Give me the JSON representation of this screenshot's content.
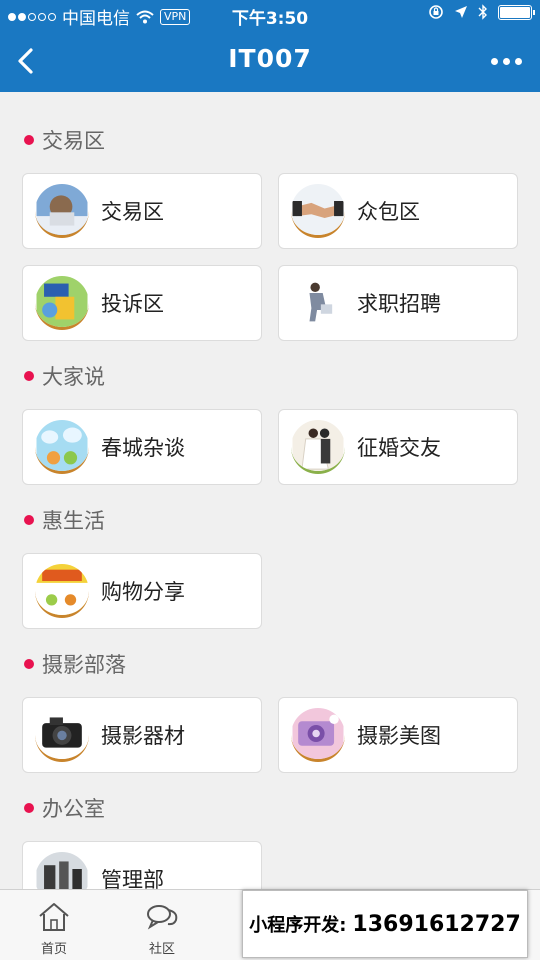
{
  "status_bar": {
    "carrier": "中国电信",
    "vpn": "VPN",
    "time": "下午3:50"
  },
  "nav": {
    "title": "IT007"
  },
  "sections": [
    {
      "title": "交易区",
      "items": [
        {
          "label": "交易区",
          "icon": "trade-icon"
        },
        {
          "label": "众包区",
          "icon": "handshake-icon"
        }
      ]
    },
    {
      "title": "",
      "items": [
        {
          "label": "投诉区",
          "icon": "complaint-icon"
        },
        {
          "label": "求职招聘",
          "icon": "job-icon"
        }
      ]
    },
    {
      "title": "大家说",
      "items": [
        {
          "label": "春城杂谈",
          "icon": "chat-icon"
        },
        {
          "label": "征婚交友",
          "icon": "wedding-icon"
        }
      ]
    },
    {
      "title": "惠生活",
      "items": [
        {
          "label": "购物分享",
          "icon": "shopping-icon"
        }
      ]
    },
    {
      "title": "摄影部落",
      "items": [
        {
          "label": "摄影器材",
          "icon": "camera-icon"
        },
        {
          "label": "摄影美图",
          "icon": "photo-icon"
        }
      ]
    },
    {
      "title": "办公室",
      "items": [
        {
          "label": "管理部",
          "icon": "office-icon"
        }
      ]
    }
  ],
  "tab_bar": {
    "tabs": [
      {
        "label": "首页",
        "icon": "home-icon"
      },
      {
        "label": "社区",
        "icon": "community-icon"
      }
    ]
  },
  "promo": {
    "label": "小程序开发:",
    "phone": "13691612727"
  },
  "colors": {
    "primary": "#1a78c2",
    "section_dot": "#e8124f",
    "background": "#f0f0f0"
  }
}
